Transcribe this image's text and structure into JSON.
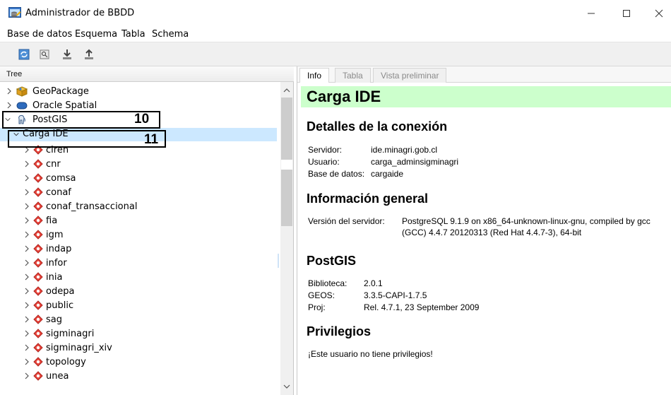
{
  "window": {
    "title": "Administrador de BBDD",
    "icon": "database-manager-icon"
  },
  "menu": [
    "Base de datos",
    "Esquema",
    "Tabla",
    "Schema"
  ],
  "toolbar": {
    "icons": [
      "refresh-icon",
      "properties-icon",
      "import-icon",
      "export-icon"
    ]
  },
  "tree": {
    "header": "Tree",
    "nodes": [
      {
        "label": "GeoPackage",
        "icon": "geopackage-icon",
        "expanded": false
      },
      {
        "label": "Oracle Spatial",
        "icon": "oracle-icon",
        "expanded": false
      },
      {
        "label": "PostGIS",
        "icon": "postgis-elephant-icon",
        "expanded": true
      },
      {
        "label": "Carga IDE",
        "expanded": true,
        "selected": true
      }
    ],
    "schemas": [
      "ciren",
      "cnr",
      "comsa",
      "conaf",
      "conaf_transaccional",
      "fia",
      "igm",
      "indap",
      "infor",
      "inia",
      "odepa",
      "public",
      "sag",
      "sigminagri",
      "sigminagri_xiv",
      "topology",
      "unea"
    ]
  },
  "callouts": [
    "10",
    "11"
  ],
  "tabs": [
    "Info",
    "Tabla",
    "Vista preliminar"
  ],
  "info": {
    "title": "Carga IDE",
    "connection": {
      "heading": "Detalles de la conexión",
      "server_label": "Servidor:",
      "server": "ide.minagri.gob.cl",
      "user_label": "Usuario:",
      "user": "carga_adminsigminagri",
      "db_label": "Base de datos:",
      "db": "cargaide"
    },
    "general": {
      "heading": "Información general",
      "version_label": "Versión del servidor:",
      "version_line1": "PostgreSQL 9.1.9 on x86_64-unknown-linux-gnu, compiled by gcc",
      "version_line2": "(GCC) 4.4.7 20120313 (Red Hat 4.4.7-3), 64-bit"
    },
    "postgis": {
      "heading": "PostGIS",
      "lib_label": "Biblioteca:",
      "lib": "2.0.1",
      "geos_label": "GEOS:",
      "geos": "3.3.5-CAPI-1.7.5",
      "proj_label": "Proj:",
      "proj": "Rel. 4.7.1, 23 September 2009"
    },
    "privileges": {
      "heading": "Privilegios",
      "text": "¡Este usuario no tiene privilegios!"
    }
  },
  "colors": {
    "banner": "#ccffcc",
    "selection": "#cce8ff",
    "schema_icon": "#e8453c"
  }
}
